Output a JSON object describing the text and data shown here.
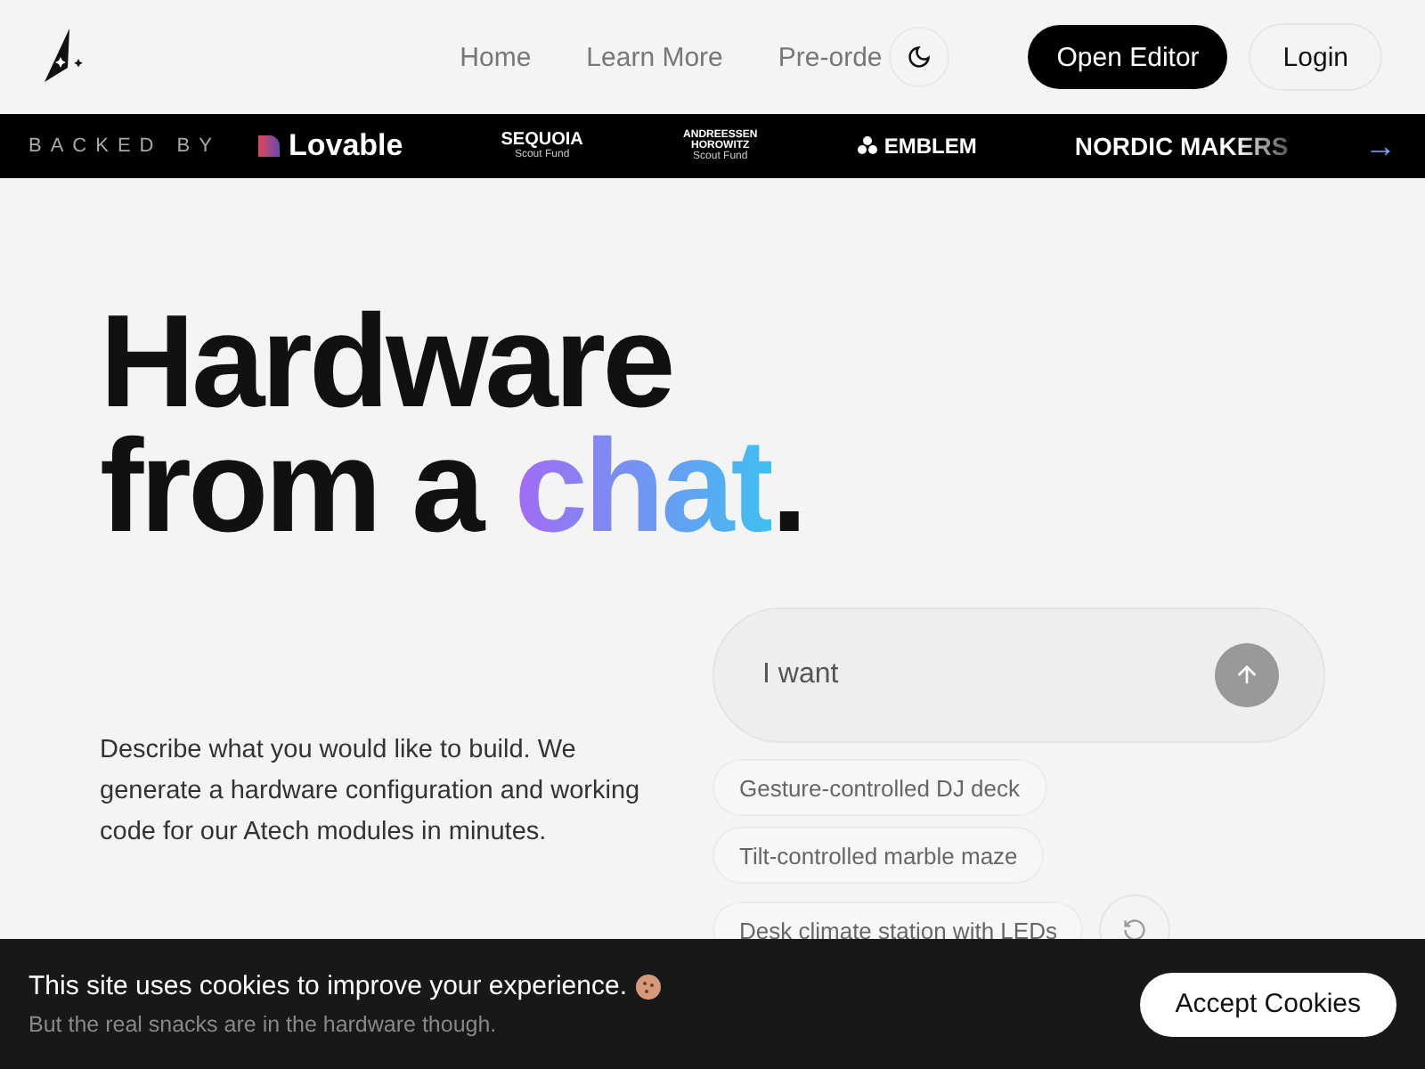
{
  "nav": {
    "links": [
      "Home",
      "Learn More",
      "Pre-orde"
    ],
    "primary_button": "Open Editor",
    "login_button": "Login"
  },
  "backers": {
    "label": "BACKED BY",
    "logos": [
      {
        "kind": "lovable",
        "name": "Lovable"
      },
      {
        "kind": "stacked",
        "name": "SEQUOIA",
        "sub": "Scout Fund"
      },
      {
        "kind": "stacked",
        "name": "ANDREESSEN HOROWITZ",
        "sub": "Scout Fund"
      },
      {
        "kind": "emblem",
        "name": "EMBLEM"
      },
      {
        "kind": "plain",
        "name": "NORDIC MAKERS"
      }
    ],
    "arrow": "→"
  },
  "hero": {
    "line1": "Hardware",
    "line2": "from a ",
    "highlight": "chat",
    "suffix": ".",
    "description": "Describe what you would like to build. We generate a hardware configuration and working code for our Atech modules in minutes."
  },
  "prompt": {
    "placeholder": "I want"
  },
  "suggestions": [
    "Gesture-controlled DJ deck",
    "Tilt-controlled marble maze",
    "Desk climate station with LEDs"
  ],
  "cookie": {
    "message": "This site uses cookies to improve your experience.",
    "note": "But the real snacks are in the hardware though.",
    "button": "Accept Cookies"
  }
}
